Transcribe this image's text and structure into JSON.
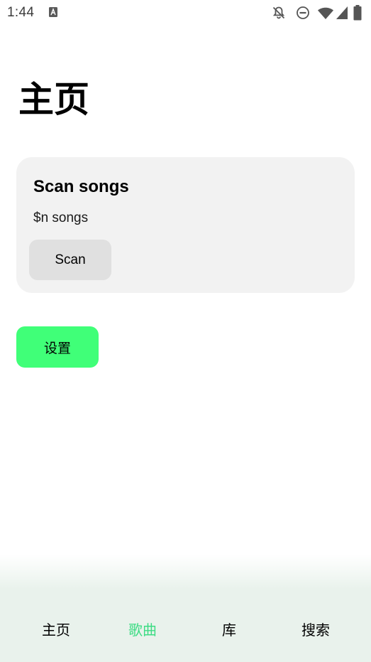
{
  "status_bar": {
    "time": "1:44",
    "icons": [
      "notification-a-icon",
      "bell-off-icon",
      "do-not-disturb-icon",
      "wifi-icon",
      "cell-signal-icon",
      "battery-icon"
    ]
  },
  "page": {
    "title": "主页"
  },
  "scan_card": {
    "title": "Scan songs",
    "subtitle": "$n songs",
    "button_label": "Scan"
  },
  "settings_button": {
    "label": "设置"
  },
  "bottom_nav": {
    "items": [
      {
        "label": "主页",
        "active": false
      },
      {
        "label": "歌曲",
        "active": true
      },
      {
        "label": "库",
        "active": false
      },
      {
        "label": "搜索",
        "active": false
      }
    ]
  },
  "colors": {
    "accent_green": "#40ff78",
    "active_tab": "#3ddc84",
    "card_bg": "#f2f2f2",
    "nav_bg": "#e9f2ec"
  }
}
